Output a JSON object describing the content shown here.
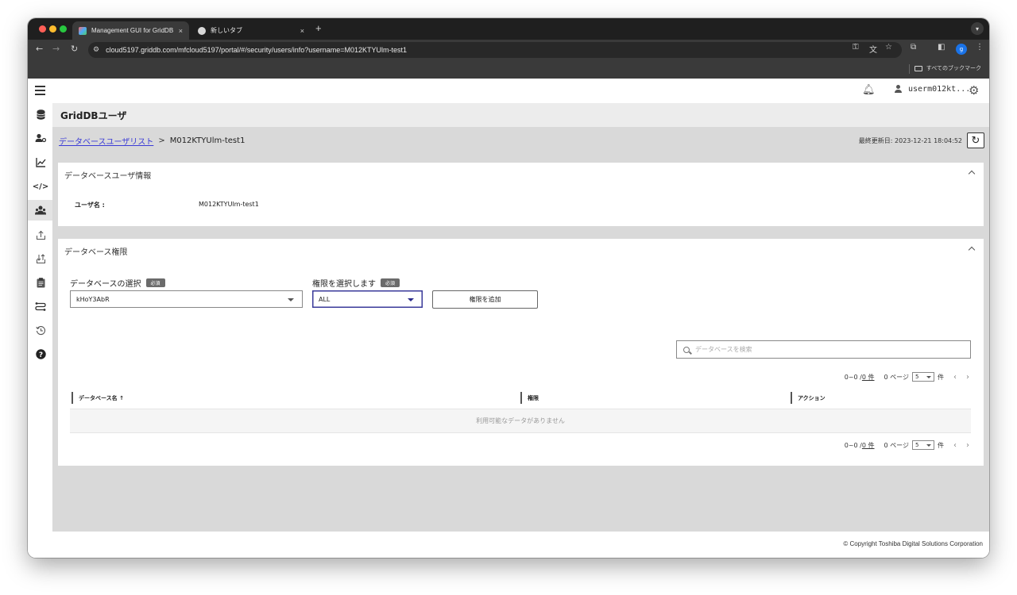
{
  "browser": {
    "tabs": [
      {
        "title": "Management GUI for GridDB",
        "close": "×"
      },
      {
        "title": "新しいタブ",
        "close": "×"
      }
    ],
    "new_tab": "+",
    "url": "cloud5197.griddb.com/mfcloud5197/portal/#/security/users/info?username=M012KTYUlm-test1",
    "profile_initial": "g",
    "bookmarks_label": "すべてのブックマーク"
  },
  "colors": {
    "accent": "#3a3a9a",
    "link": "#3b3bd6",
    "content_bg": "#d9d9d9"
  },
  "appbar": {
    "username": "userm012kt..."
  },
  "sidenav": {
    "icons": [
      "database-icon",
      "user-settings-icon",
      "chart-line-icon",
      "code-icon",
      "users-icon",
      "upload-icon",
      "import-icon",
      "clipboard-icon",
      "workflow-icon",
      "history-icon",
      "help-icon"
    ]
  },
  "page": {
    "title": "GridDBユーザ",
    "breadcrumb": {
      "link": "データベースユーザリスト",
      "separator": ">",
      "current": "M012KTYUlm-test1"
    },
    "last_updated": "最終更新日: 2023-12-21 18:04:52"
  },
  "user_info_panel": {
    "title": "データベースユーザ情報",
    "username_label": "ユーザ名 :",
    "username_value": "M012KTYUlm-test1"
  },
  "privilege_panel": {
    "title": "データベース権限",
    "db_select_label": "データベースの選択",
    "required": "必須",
    "db_select_value": "kHoY3AbR",
    "priv_select_label": "権限を選択します",
    "priv_select_value": "ALL",
    "add_button": "権限を追加",
    "search_placeholder": "データベースを検索",
    "pager": {
      "range": "0~0 / ",
      "count": "0 件",
      "pages": "0 ページ",
      "per_page": "5",
      "unit": "件",
      "prev": "‹",
      "next": "›"
    },
    "columns": [
      "データベース名 ↑",
      "権限",
      "アクション"
    ],
    "empty_message": "利用可能なデータがありません"
  },
  "footer": {
    "copyright": "© Copyright Toshiba Digital Solutions Corporation"
  }
}
